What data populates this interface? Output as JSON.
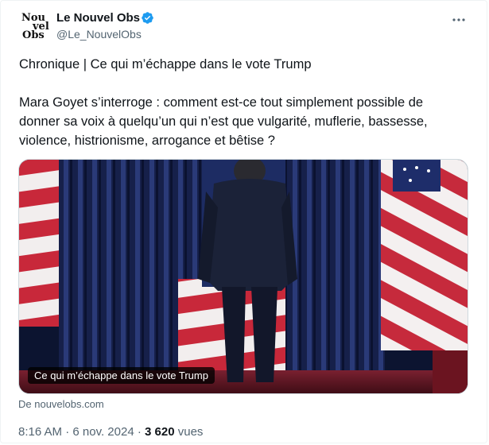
{
  "author": {
    "name": "Le Nouvel Obs",
    "handle": "@Le_NouvelObs",
    "avatar_text": [
      "Nou",
      "vel",
      "Obs"
    ],
    "verified_color": "#1d9bf0"
  },
  "more_icon": "more-horizontal-icon",
  "tweet": {
    "line1": "Chronique | Ce qui m’échappe dans le vote Trump",
    "line2": "Mara Goyet s’interroge : comment est-ce tout simplement possible de donner sa voix à quelqu’un qui n’est que vulgarité, muflerie, bassesse, violence, histrionisme, arrogance et bêtise ?"
  },
  "media": {
    "caption": "Ce qui m’échappe dans le vote Trump"
  },
  "source": "De nouvelobs.com",
  "meta": {
    "time": "8:16 AM",
    "separator1": " · ",
    "date": "6 nov. 2024",
    "separator2": " · ",
    "views_count": "3 620",
    "views_label": " vues"
  }
}
